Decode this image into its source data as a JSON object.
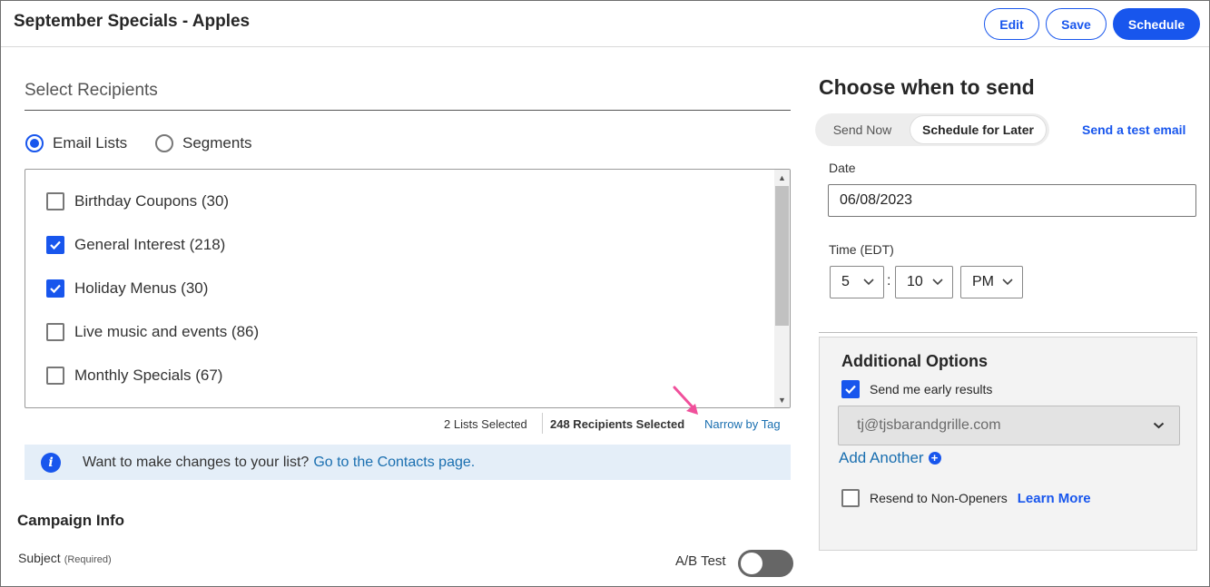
{
  "header": {
    "title": "September Specials - Apples",
    "edit_label": "Edit",
    "save_label": "Save",
    "schedule_label": "Schedule"
  },
  "recipients": {
    "section_title": "Select Recipients",
    "radio_options": [
      {
        "label": "Email Lists",
        "checked": true
      },
      {
        "label": "Segments",
        "checked": false
      }
    ],
    "lists": [
      {
        "label": "Birthday Coupons (30)",
        "checked": false
      },
      {
        "label": "General Interest (218)",
        "checked": true
      },
      {
        "label": "Holiday Menus (30)",
        "checked": true
      },
      {
        "label": "Live music and events (86)",
        "checked": false
      },
      {
        "label": "Monthly Specials (67)",
        "checked": false
      }
    ],
    "lists_selected": "2 Lists Selected",
    "recipients_selected": "248 Recipients Selected",
    "narrow_by_tag": "Narrow by Tag",
    "info_text": "Want to make changes to your list?",
    "info_link": "Go to the Contacts page."
  },
  "campaign_info": {
    "title": "Campaign Info",
    "subject_label": "Subject",
    "subject_required": "(Required)",
    "ab_test_label": "A/B Test",
    "ab_test_on": false
  },
  "schedule": {
    "title": "Choose when to send",
    "send_now": "Send Now",
    "schedule_later": "Schedule for Later",
    "test_email_link": "Send a test email",
    "date_label": "Date",
    "date_value": "06/08/2023",
    "time_label": "Time (EDT)",
    "hour": "5",
    "minute": "10",
    "ampm": "PM",
    "time_separator": ":"
  },
  "options": {
    "title": "Additional Options",
    "early_results_label": "Send me early results",
    "early_results_checked": true,
    "email_value": "tj@tjsbarandgrille.com",
    "add_another": "Add Another",
    "resend_label": "Resend to Non-Openers",
    "resend_checked": false,
    "learn_more": "Learn More"
  },
  "colors": {
    "accent": "#1856ed",
    "link": "#1a6fb0",
    "annotation_arrow": "#f0509b"
  }
}
